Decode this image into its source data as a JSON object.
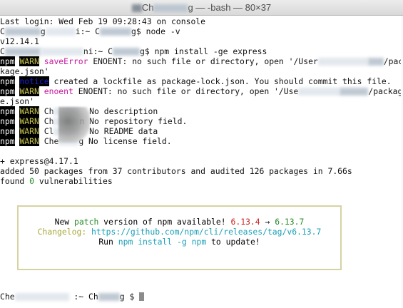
{
  "window": {
    "title_prefix": "Ch",
    "title_suffix": "g — -bash — 80×37"
  },
  "terminal": {
    "login": "Last login: Wed Feb 19 09:28:43 on console",
    "prompt1_a": "C",
    "prompt1_b": "g",
    "prompt1_c": "i:~ C",
    "prompt1_d": "g$ node -v",
    "node_version": "v12.14.1",
    "prompt2_a": "C",
    "prompt2_b": "ni:~ C",
    "prompt2_c": "g$ npm install -ge express",
    "npm": "npm",
    "warn": "WARN",
    "notice": "notice",
    "save_error_code": "saveError",
    "save_error_msg": " ENOENT: no such file or directory, open '/User",
    "save_error_tail": "/pac",
    "save_error_cont": "kage.json'",
    "notice_msg": " created a lockfile as package-lock.json. You should commit this file.",
    "enoent_code": "enoent",
    "enoent_msg": " ENOENT: no such file or directory, open '/Use",
    "enoent_tail": "/packag",
    "enoent_cont": "e.json'",
    "warn_rows": [
      {
        "pre": " Ch",
        "text": "  No description"
      },
      {
        "pre": " Ch",
        "text": "n No repository field."
      },
      {
        "pre": " Cl",
        "text": "  No README data"
      },
      {
        "pre": " Che",
        "text": "g No license field."
      }
    ],
    "installed": "+ express@4.17.1",
    "added": "added 50 packages from 37 contributors and audited 126 packages in 7.66s",
    "found_prefix": "found ",
    "found_count": "0",
    "found_suffix": " vulnerabilities",
    "update_box": {
      "line1_a": "New ",
      "line1_patch": "patch",
      "line1_b": " version of npm available! ",
      "old_version": "6.13.4",
      "arrow": " → ",
      "new_version": "6.13.7",
      "changelog_label": "Changelog:",
      "changelog_url": " https://github.com/npm/cli/releases/tag/v6.13.7",
      "run_a": "Run ",
      "run_cmd": "npm install -g npm",
      "run_b": " to update!"
    },
    "final_prompt_a": "Che",
    "final_prompt_b": " :~ Ch",
    "final_prompt_c": "g $"
  },
  "colors": {
    "warn": "#c7c44f",
    "notice": "#1d1dd8",
    "error_code": "#c7169c",
    "version_old": "#cc2222",
    "version_new": "#2a8b2a",
    "changelog": "#a8a83a",
    "url": "#1aa0b8"
  }
}
